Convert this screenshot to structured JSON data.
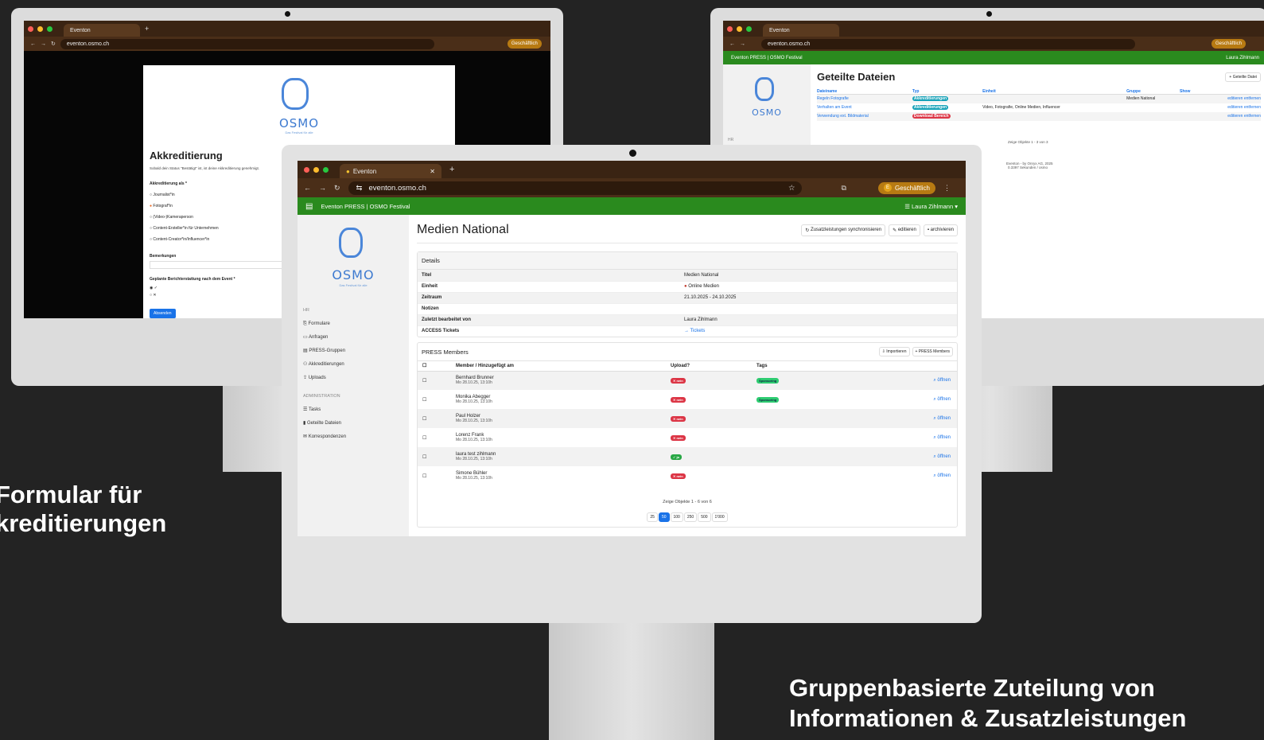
{
  "browser": {
    "tab_title": "Eventon",
    "url": "eventon.osmo.ch",
    "profile_badge": "Geschäftlich",
    "profile_initial": "E",
    "new_tab_symbol": "+"
  },
  "app_bar": {
    "title": "Eventon PRESS | OSMO Festival",
    "user": "Laura Zihlmann"
  },
  "logo": {
    "name": "OSMO",
    "tagline": "Das Festival für alle"
  },
  "sidebar": {
    "section_main": "HR",
    "items": [
      "Formulare",
      "Anfragen",
      "PRESS-Gruppen",
      "Akkreditierungen",
      "Uploads"
    ],
    "section_admin": "ADMINISTRATION",
    "admin_items": [
      "Tasks",
      "Geteilte Dateien",
      "Korrespondenzen"
    ]
  },
  "left_form": {
    "title": "Akkreditierung",
    "intro": "Sobald dein Status \"Bestätigt\" ist, ist deine Akkreditierung genehmigt.",
    "question": "Akkreditierung als *",
    "options": [
      "Journalist*in",
      "Fotograf*in",
      "(Video-)Kameraperson",
      "Content-Ersteller*in für Unternehmen",
      "Content-Creator*in/Influencer*in"
    ],
    "remarks_label": "Bemerkungen",
    "coverage_label": "Geplante Berichterstattung nach dem Event *",
    "yes": "✓",
    "no": "✕",
    "submit": "Absenden"
  },
  "right_files": {
    "title": "Geteilte Dateien",
    "add_button": "+ Geteilte Datei",
    "headers": [
      "Dateiname",
      "Typ",
      "Einheit",
      "Gruppe",
      "Show"
    ],
    "rows": [
      {
        "name": "Regeln Fotografie",
        "type": "Akkreditierungen",
        "unit": "",
        "group": "Medien National"
      },
      {
        "name": "Verhalten am Event",
        "type": "Akkreditierungen",
        "unit": "Video, Fotografie, Online Medien, Influencer",
        "group": ""
      },
      {
        "name": "Verwendung ext. Bildmaterial",
        "type": "Download Bereich",
        "unit": "",
        "group": ""
      }
    ],
    "edit": "editieren",
    "remove": "entfernen",
    "pager_info": "Zeige Objekte 1 - 3 von 3",
    "footer_1": "Eventon - by Onryx AG, 2025",
    "footer_2": "0.3397 Sekunden / osmo"
  },
  "center": {
    "title": "Medien National",
    "actions": [
      "Zusatzleistungen synchronisieren",
      "editieren",
      "archivieren"
    ],
    "details_header": "Details",
    "details": [
      {
        "k": "Titel",
        "v": "Medien National"
      },
      {
        "k": "Einheit",
        "v": "Online Medien"
      },
      {
        "k": "Zeitraum",
        "v": "21.10.2025 - 24.10.2025"
      },
      {
        "k": "Notizen",
        "v": ""
      },
      {
        "k": "Zuletzt bearbeitet von",
        "v": "Laura Zihlmann"
      },
      {
        "k": "ACCESS Tickets",
        "v": "→ Tickets"
      }
    ],
    "members_header": "PRESS Members",
    "members_actions": [
      "Importieren",
      "+ PRESS Members"
    ],
    "columns": [
      "Member / Hinzugefügt am",
      "Upload?",
      "Tags"
    ],
    "members": [
      {
        "name": "Bernhard Brunner",
        "date": "Mo 28.10.25, 13:10h",
        "upload": "✕ nein",
        "ok": false,
        "tag": "Sponsoring"
      },
      {
        "name": "Monika Abegger",
        "date": "Mo 28.10.25, 13:10h",
        "upload": "✕ nein",
        "ok": false,
        "tag": "Sponsoring"
      },
      {
        "name": "Paul Holzer",
        "date": "Mo 28.10.25, 13:10h",
        "upload": "✕ nein",
        "ok": false,
        "tag": ""
      },
      {
        "name": "Lorenz Frank",
        "date": "Mo 28.10.25, 13:10h",
        "upload": "✕ nein",
        "ok": false,
        "tag": ""
      },
      {
        "name": "laura test zihlmann",
        "date": "Mo 28.10.25, 13:10h",
        "upload": "✓ ja",
        "ok": true,
        "tag": ""
      },
      {
        "name": "Simone Bühler",
        "date": "Mo 28.10.25, 13:10h",
        "upload": "✕ nein",
        "ok": false,
        "tag": ""
      }
    ],
    "open_label": "öffnen",
    "pager_info": "Zeige Objekte 1 - 6 von 6",
    "page_sizes": [
      "25",
      "50",
      "100",
      "250",
      "500",
      "1'000"
    ],
    "page_size_active": "50"
  },
  "captions": {
    "left_line1": "Formular für",
    "left_line2": "kreditierungen",
    "right_line1": "Gruppenbasierte Zuteilung von",
    "right_line2": "Informationen & Zusatzleistungen"
  },
  "colors": {
    "background": "#232323",
    "browser_chrome": "#3a2413",
    "app_bar": "#2a8a1e",
    "accent_blue": "#1a73e8",
    "danger": "#dc3545",
    "success": "#28a745",
    "tag_green": "#2ecc71"
  }
}
